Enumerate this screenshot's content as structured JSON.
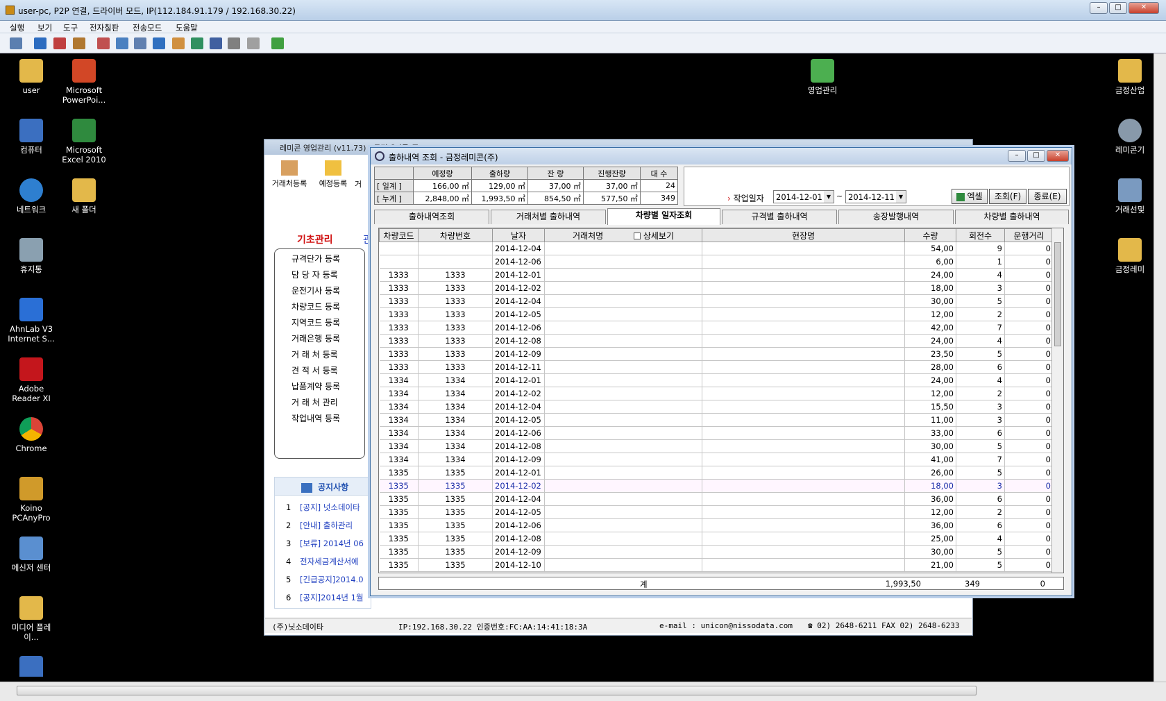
{
  "remote": {
    "title": "user-pc, P2P 연결, 드라이버 모드, IP(112.184.91.179 / 192.168.30.22)",
    "menu": [
      "실행",
      "보기",
      "도구",
      "전자칠판",
      "전송모드",
      "도움말"
    ],
    "wbtns": [
      "–",
      "□",
      "✕"
    ]
  },
  "desktop": {
    "icons": [
      "user",
      "Microsoft PowerPoi...",
      "컴퓨터",
      "Microsoft Excel 2010",
      "네트워크",
      "새 폴더",
      "휴지통",
      "AhnLab V3 Internet S...",
      "Adobe Reader XI",
      "Chrome",
      "Koino PCAnyPro",
      "메신저 센터",
      "미디어 플레이...",
      "영업관리",
      "금정산업",
      "레미콘기",
      "거래선및",
      "금정레미"
    ]
  },
  "bgapp": {
    "title": "레미콘 영업관리 (v11.73) - 금정레미콘(주)",
    "toolbar": [
      "거래처등록",
      "예정등록",
      "거"
    ],
    "section": "기초관리",
    "section2": "관",
    "nav": [
      "규격단가 등록",
      "담 당 자 등록",
      "운전기사 등록",
      "차량코드 등록",
      "지역코드 등록",
      "거래은행 등록",
      "거 래 처 등록",
      "견 적 서 등록",
      "납품계약 등록",
      "거 래 처 관리",
      "작업내역 등록"
    ],
    "notice_title": "공지사항",
    "notices": [
      [
        "1",
        "[공지] 넛소데이타"
      ],
      [
        "2",
        "[안내] 출하관리"
      ],
      [
        "3",
        "[보류] 2014년 06"
      ],
      [
        "4",
        "전자세금계산서에"
      ],
      [
        "5",
        "[긴급공지]2014.0"
      ],
      [
        "6",
        "[공지]2014년 1월"
      ]
    ],
    "status": {
      "company": "(주)닛소데이타",
      "ip": "IP:192.168.30.22  인증번호:FC:AA:14:41:18:3A",
      "email": "e-mail : unicon@nissodata.com",
      "phone": "☎ 02) 2648-6211  FAX  02) 2648-6233"
    }
  },
  "dialog": {
    "title": "출하내역 조회 - 금정레미콘(주)",
    "summary": {
      "headers": [
        "",
        "예정량",
        "출하량",
        "잔 량",
        "진행잔량",
        "대 수"
      ],
      "rows": [
        [
          "[ 일계 ]",
          "166,00 ㎥",
          "129,00 ㎥",
          "37,00 ㎥",
          "37,00 ㎥",
          "24"
        ],
        [
          "[ 누계 ]",
          "2,848,00 ㎥",
          "1,993,50 ㎥",
          "854,50 ㎥",
          "577,50 ㎥",
          "349"
        ]
      ]
    },
    "date_label": "작업일자",
    "date_from": "2014-12-01",
    "tilde": "~",
    "date_to": "2014-12-11",
    "buttons": {
      "excel": "엑셀",
      "query": "조회(F)",
      "close": "종료(E)"
    },
    "tabs": [
      "출하내역조회",
      "거래처별 출하내역",
      "차량별 일자조회",
      "규격별 출하내역",
      "송장발행내역",
      "차량별 출하내역"
    ],
    "active_tab": 2,
    "grid_headers": [
      "차량코드",
      "차량번호",
      "날자",
      "거래처명",
      "상세보기",
      "현장명",
      "수량",
      "회전수",
      "운행거리"
    ],
    "rows": [
      [
        "",
        "",
        "2014-12-04",
        "54,00",
        "9",
        "0"
      ],
      [
        "",
        "",
        "2014-12-06",
        "6,00",
        "1",
        "0"
      ],
      [
        "1333",
        "1333",
        "2014-12-01",
        "24,00",
        "4",
        "0"
      ],
      [
        "1333",
        "1333",
        "2014-12-02",
        "18,00",
        "3",
        "0"
      ],
      [
        "1333",
        "1333",
        "2014-12-04",
        "30,00",
        "5",
        "0"
      ],
      [
        "1333",
        "1333",
        "2014-12-05",
        "12,00",
        "2",
        "0"
      ],
      [
        "1333",
        "1333",
        "2014-12-06",
        "42,00",
        "7",
        "0"
      ],
      [
        "1333",
        "1333",
        "2014-12-08",
        "24,00",
        "4",
        "0"
      ],
      [
        "1333",
        "1333",
        "2014-12-09",
        "23,50",
        "5",
        "0"
      ],
      [
        "1333",
        "1333",
        "2014-12-11",
        "28,00",
        "6",
        "0"
      ],
      [
        "1334",
        "1334",
        "2014-12-01",
        "24,00",
        "4",
        "0"
      ],
      [
        "1334",
        "1334",
        "2014-12-02",
        "12,00",
        "2",
        "0"
      ],
      [
        "1334",
        "1334",
        "2014-12-04",
        "15,50",
        "3",
        "0"
      ],
      [
        "1334",
        "1334",
        "2014-12-05",
        "11,00",
        "3",
        "0"
      ],
      [
        "1334",
        "1334",
        "2014-12-06",
        "33,00",
        "6",
        "0"
      ],
      [
        "1334",
        "1334",
        "2014-12-08",
        "30,00",
        "5",
        "0"
      ],
      [
        "1334",
        "1334",
        "2014-12-09",
        "41,00",
        "7",
        "0"
      ],
      [
        "1335",
        "1335",
        "2014-12-01",
        "26,00",
        "5",
        "0"
      ],
      [
        "1335",
        "1335",
        "2014-12-02",
        "18,00",
        "3",
        "0"
      ],
      [
        "1335",
        "1335",
        "2014-12-04",
        "36,00",
        "6",
        "0"
      ],
      [
        "1335",
        "1335",
        "2014-12-05",
        "12,00",
        "2",
        "0"
      ],
      [
        "1335",
        "1335",
        "2014-12-06",
        "36,00",
        "6",
        "0"
      ],
      [
        "1335",
        "1335",
        "2014-12-08",
        "25,00",
        "4",
        "0"
      ],
      [
        "1335",
        "1335",
        "2014-12-09",
        "30,00",
        "5",
        "0"
      ],
      [
        "1335",
        "1335",
        "2014-12-10",
        "21,00",
        "5",
        "0"
      ]
    ],
    "selected_row": 18,
    "total": {
      "label": "계",
      "qty": "1,993,50",
      "turns": "349",
      "dist": "0"
    }
  }
}
